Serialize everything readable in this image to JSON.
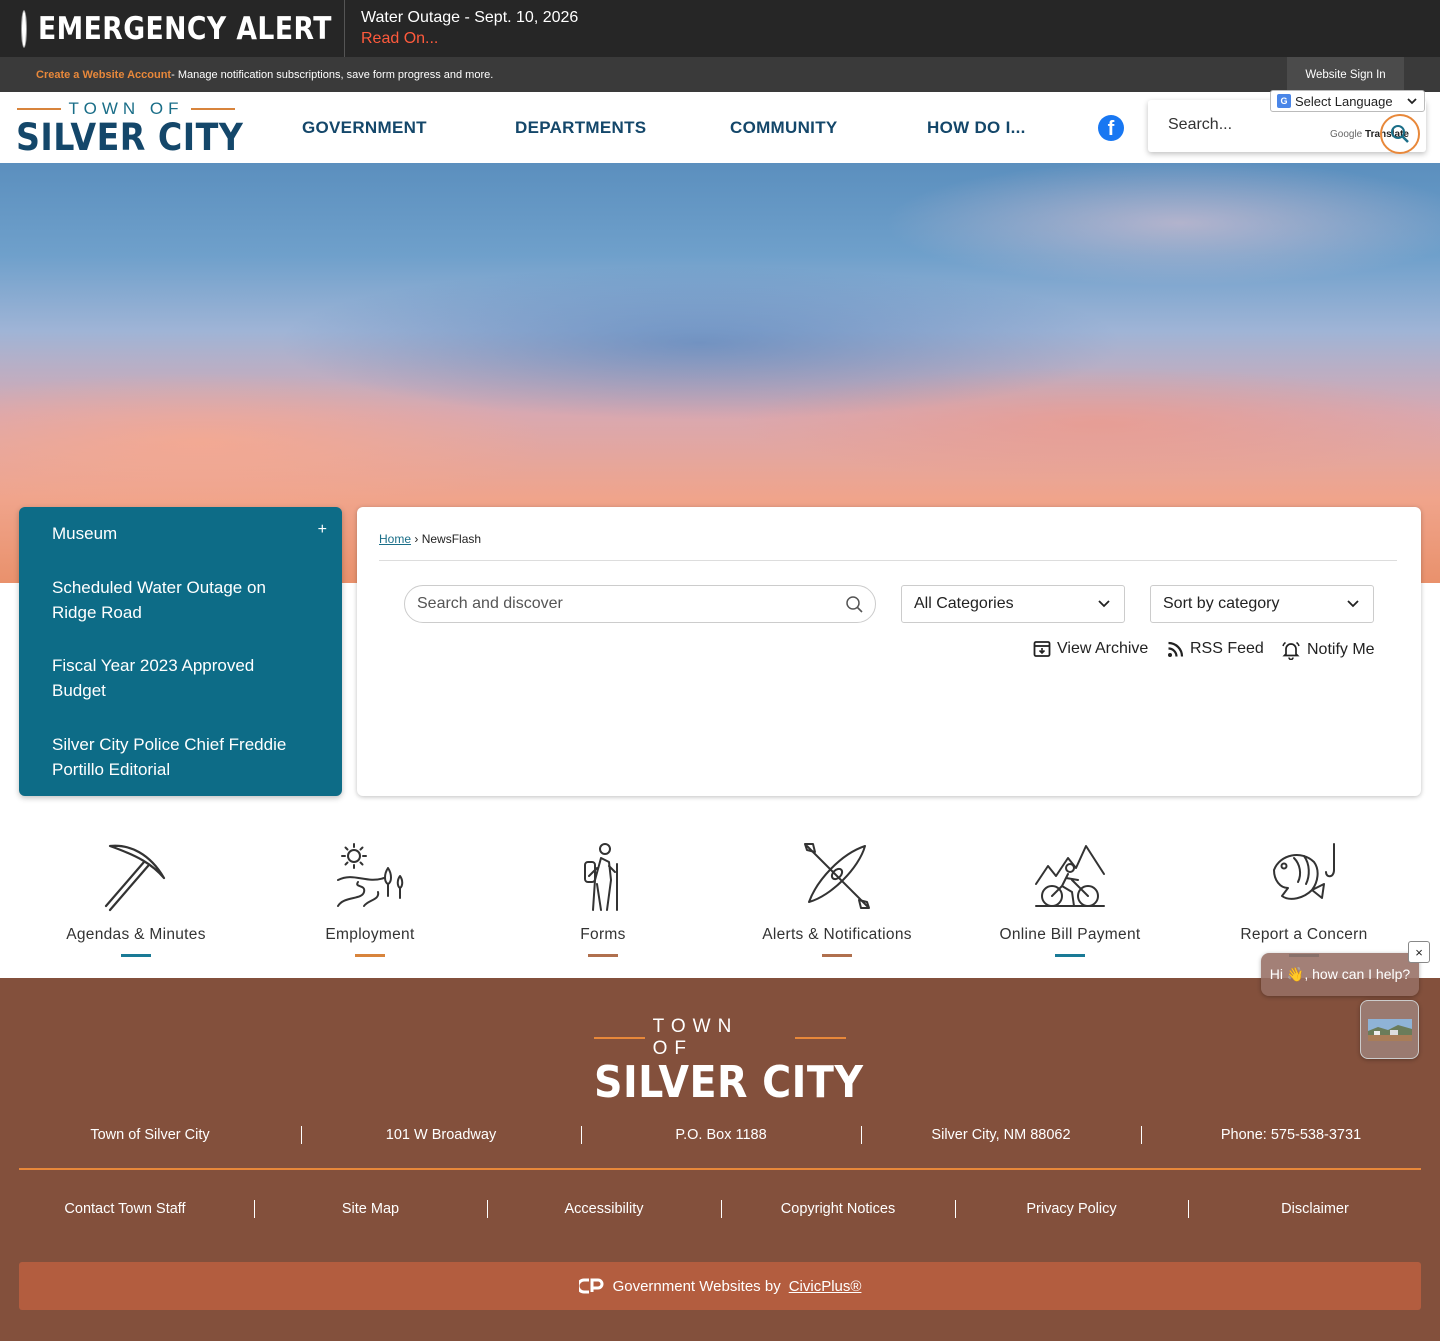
{
  "alert": {
    "title": "EMERGENCY ALERT",
    "message": "Water Outage - Sept. 10, 2026",
    "link": "Read On..."
  },
  "account_bar": {
    "create_link": "Create a Website Account",
    "description": " - Manage notification subscriptions, save form progress and more.",
    "signin": "Website Sign In"
  },
  "logo": {
    "top": "TOWN OF",
    "main": "SILVER CITY"
  },
  "nav": [
    "GOVERNMENT",
    "DEPARTMENTS",
    "COMMUNITY",
    "HOW DO I..."
  ],
  "header_search": {
    "placeholder": "Search...",
    "translate_google": "Google",
    "translate_word": "Translate"
  },
  "language_select": "Select Language",
  "sidebar": {
    "heading": "Museum",
    "toggle": "+",
    "items": [
      "Scheduled Water Outage on Ridge Road",
      "Fiscal Year 2023 Approved Budget",
      "Silver City Police Chief Freddie Portillo Editorial"
    ]
  },
  "breadcrumb": {
    "home": "Home",
    "separator": "›",
    "current": "NewsFlash"
  },
  "panel": {
    "search_placeholder": "Search and discover",
    "categories": "All Categories",
    "sort": "Sort by category",
    "actions": [
      "View Archive",
      "RSS Feed",
      "Notify Me"
    ]
  },
  "quick_links": [
    {
      "label": "Agendas & Minutes",
      "icon": "pickaxe-icon",
      "bar_color": "#1a7a96"
    },
    {
      "label": "Employment",
      "icon": "landscape-icon",
      "bar_color": "#d8843c"
    },
    {
      "label": "Forms",
      "icon": "hiker-icon",
      "bar_color": "#b0704e"
    },
    {
      "label": "Alerts & Notifications",
      "icon": "kayak-icon",
      "bar_color": "#b0704e"
    },
    {
      "label": "Online Bill Payment",
      "icon": "cyclist-icon",
      "bar_color": "#1a7a96"
    },
    {
      "label": "Report a Concern",
      "icon": "fish-icon",
      "bar_color": "#1a7a96"
    }
  ],
  "footer": {
    "logo_top": "TOWN OF",
    "logo_main": "SILVER CITY",
    "contact": [
      "Town of Silver City",
      "101 W Broadway",
      "P.O. Box 1188",
      "Silver City, NM 88062",
      "Phone: 575-538-3731"
    ],
    "links": [
      "Contact Town Staff",
      "Site Map",
      "Accessibility",
      "Copyright Notices",
      "Privacy Policy",
      "Disclaimer"
    ],
    "credit_text": "Government Websites by",
    "credit_link": "CivicPlus®"
  },
  "chat": {
    "greeting": "Hi 👋, how can I help?",
    "close": "×"
  },
  "colors": {
    "alert_bg": "#262626",
    "alert_link": "#ff5a3c",
    "brand_teal": "#0d6c87",
    "brand_navy": "#14476a",
    "accent_orange": "#e8883a",
    "footer_brown": "#83503c",
    "credit_bar": "#b35d3f"
  }
}
